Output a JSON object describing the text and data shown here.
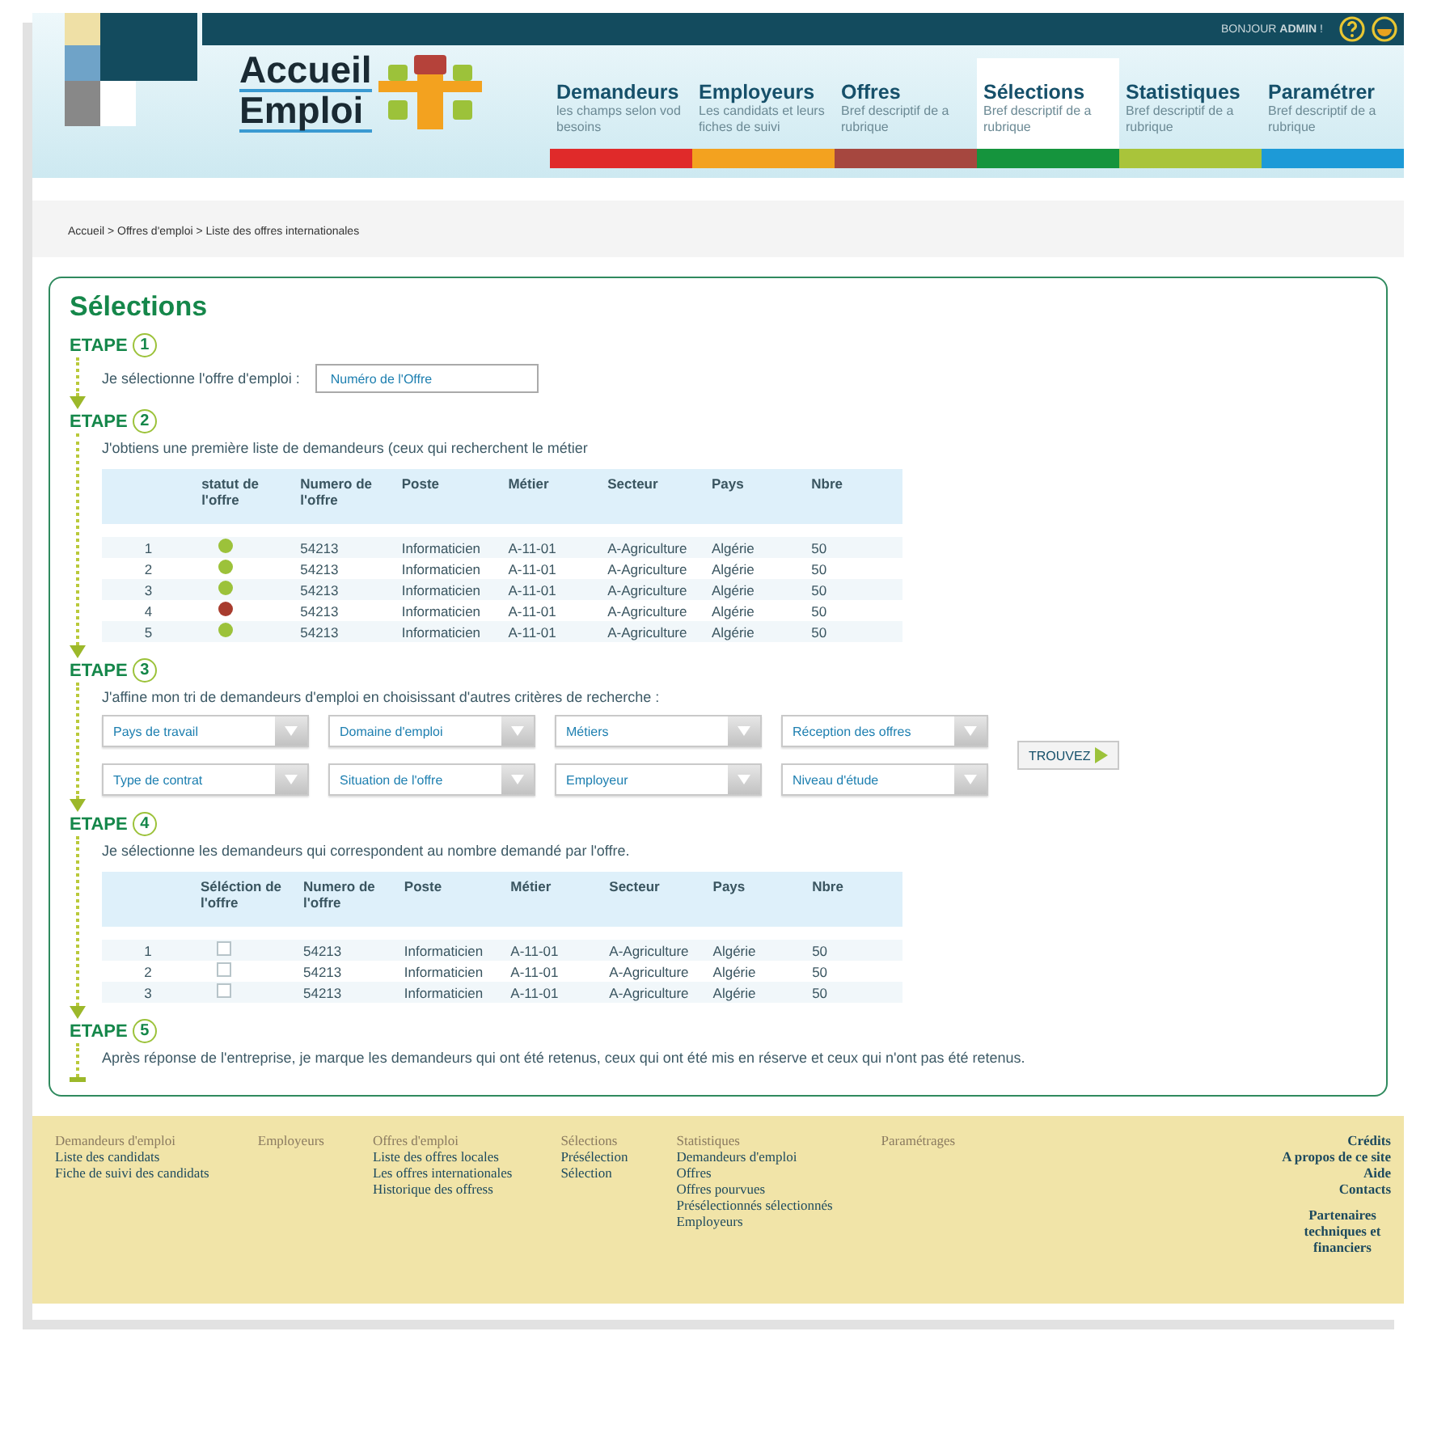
{
  "header": {
    "greeting": "BONJOUR **ADMIN** !",
    "logo": [
      "Accueil",
      "Emploi"
    ],
    "nav": [
      {
        "title": "Demandeurs",
        "desc": "les champs selon vod besoins",
        "color": "#e02a2a",
        "selected": false
      },
      {
        "title": "Employeurs",
        "desc": "Les candidats et leurs fiches de suivi",
        "color": "#f3a21f",
        "selected": false
      },
      {
        "title": "Offres",
        "desc": "Bref descriptif de a rubrique",
        "color": "#a6473f",
        "selected": false
      },
      {
        "title": "Sélections",
        "desc": "Bref descriptif de a rubrique",
        "color": "#15943d",
        "selected": true
      },
      {
        "title": "Statistiques",
        "desc": "Bref descriptif de a rubrique",
        "color": "#a9c43a",
        "selected": false
      },
      {
        "title": "Paramétrer",
        "desc": "Bref descriptif de a rubrique",
        "color": "#1d9ad7",
        "selected": false
      }
    ]
  },
  "breadcrumb": "Accueil > Offres d'emploi > Liste des offres internationales",
  "title": "Sélections",
  "steps": [
    {
      "kind": "field",
      "label": "ETAPE",
      "number": "1",
      "text": "Je sélectionne l'offre d'emploi :",
      "placeholder": "Numéro de l'Offre"
    },
    {
      "kind": "status_table",
      "label": "ETAPE",
      "number": "2",
      "text": "J'obtiens une première liste de demandeurs (ceux qui recherchent le métier",
      "columns": [
        "statut de l'offre",
        "Numero de l'offre",
        "Poste",
        "Métier",
        "Secteur",
        "Pays",
        "Nbre"
      ],
      "rows": [
        {
          "index": "1",
          "color": "#9cc23a",
          "numero": "54213",
          "poste": "Informaticien",
          "metier": "A-11-01",
          "secteur": "A-Agriculture",
          "pays": "Algérie",
          "nbre": "50"
        },
        {
          "index": "2",
          "color": "#9cc23a",
          "numero": "54213",
          "poste": "Informaticien",
          "metier": "A-11-01",
          "secteur": "A-Agriculture",
          "pays": "Algérie",
          "nbre": "50"
        },
        {
          "index": "3",
          "color": "#9cc23a",
          "numero": "54213",
          "poste": "Informaticien",
          "metier": "A-11-01",
          "secteur": "A-Agriculture",
          "pays": "Algérie",
          "nbre": "50"
        },
        {
          "index": "4",
          "color": "#a83c2e",
          "numero": "54213",
          "poste": "Informaticien",
          "metier": "A-11-01",
          "secteur": "A-Agriculture",
          "pays": "Algérie",
          "nbre": "50"
        },
        {
          "index": "5",
          "color": "#9cc23a",
          "numero": "54213",
          "poste": "Informaticien",
          "metier": "A-11-01",
          "secteur": "A-Agriculture",
          "pays": "Algérie",
          "nbre": "50"
        }
      ]
    },
    {
      "kind": "filters",
      "label": "ETAPE",
      "number": "3",
      "text": "J'affine mon tri de demandeurs d'emploi en choisissant d'autres critères de recherche :",
      "filters": [
        "Pays de travail",
        "Domaine d'emploi",
        "Métiers",
        "Réception des offres",
        "Type de contrat",
        "Situation de l'offre",
        "Employeur",
        "Niveau d'étude"
      ],
      "button": "TROUVEZ"
    },
    {
      "kind": "select_table",
      "label": "ETAPE",
      "number": "4",
      "text": "Je sélectionne les demandeurs qui correspondent au nombre demandé par l'offre.",
      "columns": [
        "Séléction de l'offre",
        "Numero de l'offre",
        "Poste",
        "Métier",
        "Secteur",
        "Pays",
        "Nbre"
      ],
      "rows": [
        {
          "index": "1",
          "checked": false,
          "numero": "54213",
          "poste": "Informaticien",
          "metier": "A-11-01",
          "secteur": "A-Agriculture",
          "pays": "Algérie",
          "nbre": "50"
        },
        {
          "index": "2",
          "checked": false,
          "numero": "54213",
          "poste": "Informaticien",
          "metier": "A-11-01",
          "secteur": "A-Agriculture",
          "pays": "Algérie",
          "nbre": "50"
        },
        {
          "index": "3",
          "checked": false,
          "numero": "54213",
          "poste": "Informaticien",
          "metier": "A-11-01",
          "secteur": "A-Agriculture",
          "pays": "Algérie",
          "nbre": "50"
        }
      ]
    },
    {
      "kind": "text",
      "label": "ETAPE",
      "number": "5",
      "text": "Après réponse de l'entreprise, je marque les demandeurs qui ont été retenus, ceux qui ont été mis en réserve et ceux qui n'ont pas été retenus."
    }
  ],
  "footer": [
    {
      "heading": "Demandeurs d'emploi",
      "links": [
        "Liste des candidats",
        "Fiche de suivi des candidats"
      ]
    },
    {
      "heading": "Employeurs"
    },
    {
      "heading": "Offres d'emploi",
      "links": [
        "Liste des offres locales",
        "Les offres internationales",
        "Historique des offress"
      ]
    },
    {
      "heading": "Sélections",
      "links": [
        "Présélection",
        "Sélection"
      ]
    },
    {
      "heading": "Statistiques",
      "links": [
        "Demandeurs d'emploi",
        "Offres",
        "Offres pourvues",
        "Présélectionnés sélectionnés",
        "Employeurs"
      ]
    },
    {
      "heading": "Paramétrages"
    }
  ],
  "footer_right": {
    "heading": "Crédits",
    "links": [
      "A propos de ce site",
      "Aide",
      "Contacts"
    ],
    "partners": "Partenaires techniques et financiers"
  }
}
